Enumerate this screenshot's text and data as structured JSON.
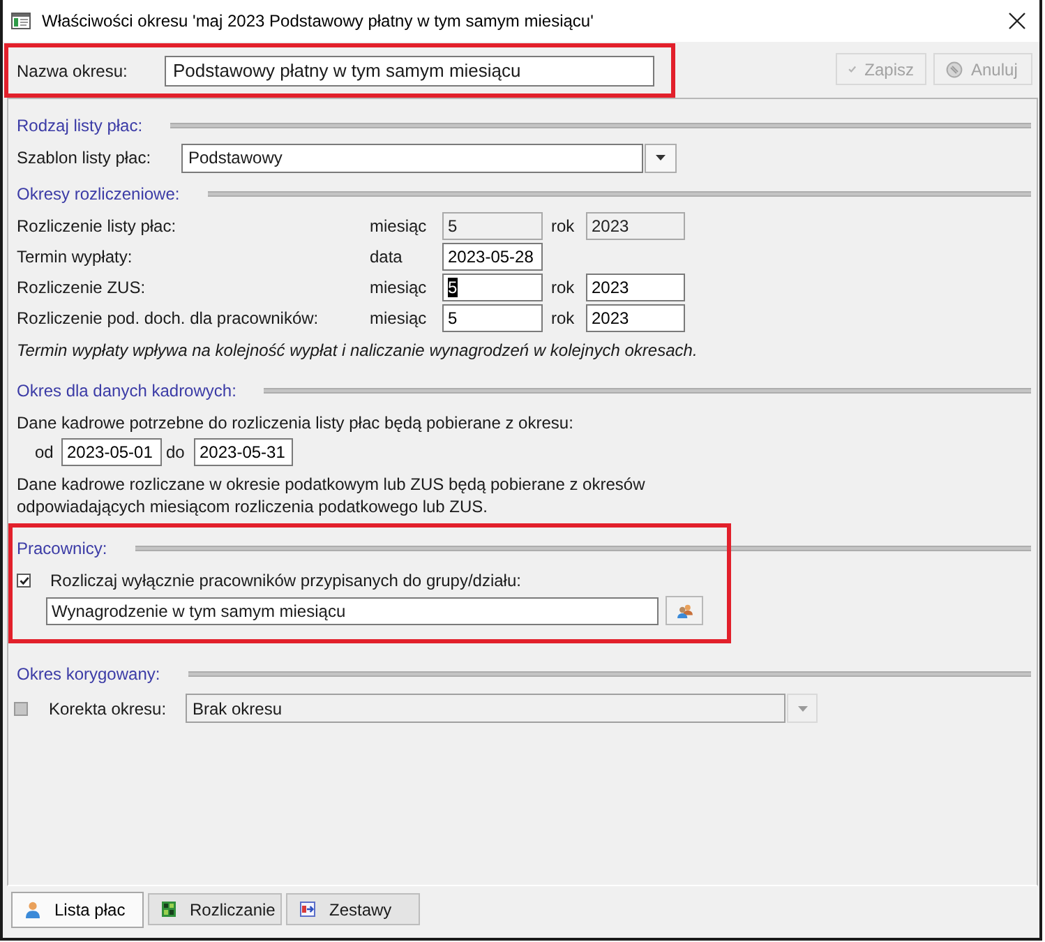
{
  "window": {
    "title": "Właściwości okresu 'maj 2023 Podstawowy płatny w tym samym miesiącu'"
  },
  "header": {
    "highlighted": true,
    "name_label": "Nazwa okresu:",
    "name_value": "Podstawowy płatny w tym samym miesiącu",
    "buttons": [
      {
        "label": "Zapisz",
        "kind": "save",
        "disabled": true
      },
      {
        "label": "Anuluj",
        "kind": "cancel",
        "disabled": true
      }
    ]
  },
  "sections": [
    {
      "kind": "template",
      "title": "Rodzaj listy płac:",
      "label": "Szablon listy płac:",
      "value": "Podstawowy"
    },
    {
      "kind": "periods",
      "title": "Okresy rozliczeniowe:",
      "rows": [
        {
          "label": "Rozliczenie listy płac:",
          "fields": [
            {
              "label": "miesiąc",
              "value": "5",
              "disabled": true,
              "text_selected": false
            },
            {
              "label": "rok",
              "value": "2023",
              "disabled": true,
              "text_selected": false
            }
          ]
        },
        {
          "label": "Termin wypłaty:",
          "fields": [
            {
              "label": "data",
              "value": "2023-05-28",
              "disabled": false,
              "text_selected": false
            }
          ]
        },
        {
          "label": "Rozliczenie ZUS:",
          "fields": [
            {
              "label": "miesiąc",
              "value": "5",
              "disabled": false,
              "text_selected": true
            },
            {
              "label": "rok",
              "value": "2023",
              "disabled": false,
              "text_selected": false
            }
          ]
        },
        {
          "label": "Rozliczenie pod. doch. dla pracowników:",
          "fields": [
            {
              "label": "miesiąc",
              "value": "5",
              "disabled": false,
              "text_selected": false
            },
            {
              "label": "rok",
              "value": "2023",
              "disabled": false,
              "text_selected": false
            }
          ]
        }
      ],
      "note": "Termin wypłaty wpływa na kolejność wypłat i naliczanie wynagrodzeń w kolejnych okresach."
    },
    {
      "kind": "hr_period",
      "title": "Okres dla danych kadrowych:",
      "intro": "Dane kadrowe potrzebne do rozliczenia listy płac będą pobierane z okresu:",
      "from_label": "od",
      "from_value": "2023-05-01",
      "to_label": "do",
      "to_value": "2023-05-31",
      "note": "Dane kadrowe rozliczane w okresie podatkowym lub ZUS będą pobierane z okresów odpowiadających miesiącom rozliczenia podatkowego lub ZUS."
    },
    {
      "kind": "employees",
      "title": "Pracownicy:",
      "highlighted": true,
      "checkbox_label": "Rozliczaj wyłącznie pracowników przypisanych do grupy/działu:",
      "checked": true,
      "group_value": "Wynagrodzenie w tym samym miesiącu"
    },
    {
      "kind": "correction",
      "title": "Okres korygowany:",
      "checked": false,
      "disabled": true,
      "label": "Korekta okresu:",
      "value": "Brak okresu"
    }
  ],
  "tabs": [
    {
      "label": "Lista płac",
      "kind": "person",
      "selected": true
    },
    {
      "label": "Rozliczanie",
      "kind": "grid",
      "selected": false
    },
    {
      "label": "Zestawy",
      "kind": "set",
      "selected": false
    }
  ]
}
